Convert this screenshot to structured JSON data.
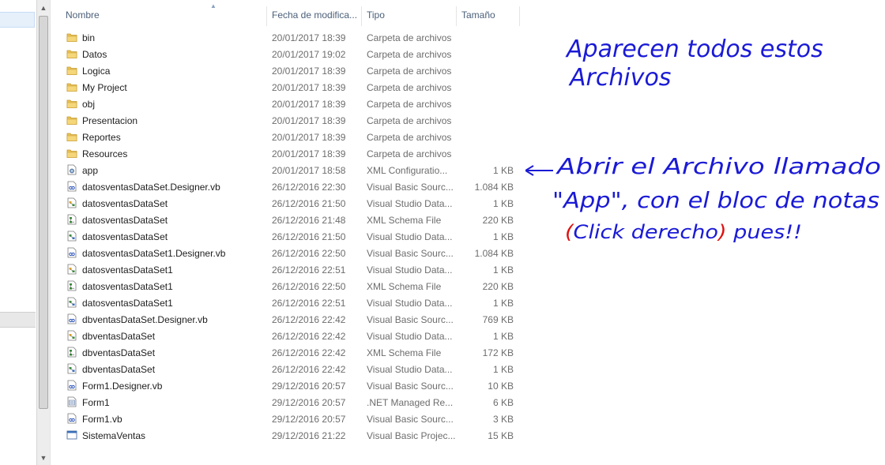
{
  "columns": {
    "name": "Nombre",
    "date": "Fecha de modifica...",
    "type": "Tipo",
    "size": "Tamaño"
  },
  "files": [
    {
      "name": "bin",
      "date": "20/01/2017 18:39",
      "type": "Carpeta de archivos",
      "size": "",
      "icon": "folder-icon"
    },
    {
      "name": "Datos",
      "date": "20/01/2017 19:02",
      "type": "Carpeta de archivos",
      "size": "",
      "icon": "folder-icon"
    },
    {
      "name": "Logica",
      "date": "20/01/2017 18:39",
      "type": "Carpeta de archivos",
      "size": "",
      "icon": "folder-icon"
    },
    {
      "name": "My Project",
      "date": "20/01/2017 18:39",
      "type": "Carpeta de archivos",
      "size": "",
      "icon": "folder-icon"
    },
    {
      "name": "obj",
      "date": "20/01/2017 18:39",
      "type": "Carpeta de archivos",
      "size": "",
      "icon": "folder-icon"
    },
    {
      "name": "Presentacion",
      "date": "20/01/2017 18:39",
      "type": "Carpeta de archivos",
      "size": "",
      "icon": "folder-icon"
    },
    {
      "name": "Reportes",
      "date": "20/01/2017 18:39",
      "type": "Carpeta de archivos",
      "size": "",
      "icon": "folder-icon"
    },
    {
      "name": "Resources",
      "date": "20/01/2017 18:39",
      "type": "Carpeta de archivos",
      "size": "",
      "icon": "folder-icon"
    },
    {
      "name": "app",
      "date": "20/01/2017 18:58",
      "type": "XML Configuratio...",
      "size": "1 KB",
      "icon": "config-file-icon"
    },
    {
      "name": "datosventasDataSet.Designer.vb",
      "date": "26/12/2016 22:30",
      "type": "Visual Basic Sourc...",
      "size": "1.084 KB",
      "icon": "vb-file-icon"
    },
    {
      "name": "datosventasDataSet",
      "date": "26/12/2016 21:50",
      "type": "Visual Studio Data...",
      "size": "1 KB",
      "icon": "dataset-file-icon"
    },
    {
      "name": "datosventasDataSet",
      "date": "26/12/2016 21:48",
      "type": "XML Schema File",
      "size": "220 KB",
      "icon": "schema-file-icon"
    },
    {
      "name": "datosventasDataSet",
      "date": "26/12/2016 21:50",
      "type": "Visual Studio Data...",
      "size": "1 KB",
      "icon": "dataset-layout-icon"
    },
    {
      "name": "datosventasDataSet1.Designer.vb",
      "date": "26/12/2016 22:50",
      "type": "Visual Basic Sourc...",
      "size": "1.084 KB",
      "icon": "vb-file-icon"
    },
    {
      "name": "datosventasDataSet1",
      "date": "26/12/2016 22:51",
      "type": "Visual Studio Data...",
      "size": "1 KB",
      "icon": "dataset-file-icon"
    },
    {
      "name": "datosventasDataSet1",
      "date": "26/12/2016 22:50",
      "type": "XML Schema File",
      "size": "220 KB",
      "icon": "schema-file-icon"
    },
    {
      "name": "datosventasDataSet1",
      "date": "26/12/2016 22:51",
      "type": "Visual Studio Data...",
      "size": "1 KB",
      "icon": "dataset-layout-icon"
    },
    {
      "name": "dbventasDataSet.Designer.vb",
      "date": "26/12/2016 22:42",
      "type": "Visual Basic Sourc...",
      "size": "769 KB",
      "icon": "vb-file-icon"
    },
    {
      "name": "dbventasDataSet",
      "date": "26/12/2016 22:42",
      "type": "Visual Studio Data...",
      "size": "1 KB",
      "icon": "dataset-file-icon"
    },
    {
      "name": "dbventasDataSet",
      "date": "26/12/2016 22:42",
      "type": "XML Schema File",
      "size": "172 KB",
      "icon": "schema-file-icon"
    },
    {
      "name": "dbventasDataSet",
      "date": "26/12/2016 22:42",
      "type": "Visual Studio Data...",
      "size": "1 KB",
      "icon": "dataset-layout-icon"
    },
    {
      "name": "Form1.Designer.vb",
      "date": "29/12/2016 20:57",
      "type": "Visual Basic Sourc...",
      "size": "10 KB",
      "icon": "vb-file-icon"
    },
    {
      "name": "Form1",
      "date": "29/12/2016 20:57",
      "type": ".NET Managed Re...",
      "size": "6 KB",
      "icon": "resx-file-icon"
    },
    {
      "name": "Form1.vb",
      "date": "29/12/2016 20:57",
      "type": "Visual Basic Sourc...",
      "size": "3 KB",
      "icon": "vb-file-icon"
    },
    {
      "name": "SistemaVentas",
      "date": "29/12/2016 21:22",
      "type": "Visual Basic Projec...",
      "size": "15 KB",
      "icon": "vbproj-file-icon"
    }
  ],
  "annotation": {
    "line1": "Aparecen todos estos",
    "line2": "Archivos",
    "line3": "Abrir el Archivo llamado",
    "line4": "\"App\", con el bloc de notas",
    "line5_open": "(",
    "line5_middle": "Click derecho",
    "line5_close": ")",
    "line5_end": " pues!!",
    "ink_color": "#1a1ad6",
    "accent_color": "#e01010"
  }
}
